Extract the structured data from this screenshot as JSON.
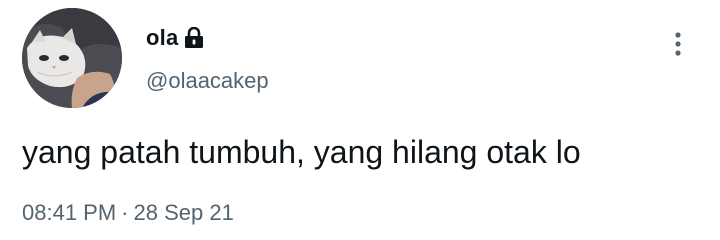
{
  "author": {
    "display_name": "ola",
    "handle": "@olaacakep",
    "protected_icon": "lock-icon",
    "avatar_icon": "cat-avatar"
  },
  "menu": {
    "icon": "more-vertical-icon"
  },
  "tweet": {
    "text": "yang patah tumbuh, yang hilang otak lo",
    "time": "08:41 PM",
    "separator": "·",
    "date": "28 Sep 21"
  },
  "colors": {
    "text": "#0f1419",
    "secondary": "#536471"
  }
}
